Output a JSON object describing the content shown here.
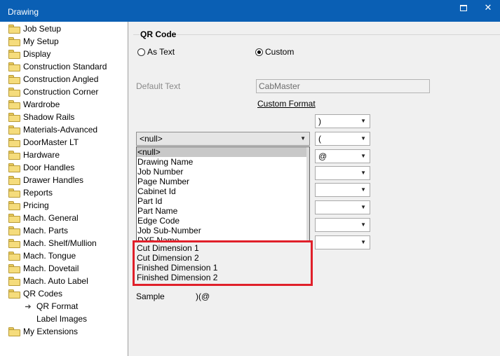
{
  "window": {
    "title": "Drawing",
    "maximize_icon": "maximize-icon",
    "close_label": "✕"
  },
  "tree": {
    "items": [
      {
        "label": "Job Setup"
      },
      {
        "label": "My Setup"
      },
      {
        "label": "Display"
      },
      {
        "label": "Construction Standard"
      },
      {
        "label": "Construction Angled"
      },
      {
        "label": "Construction Corner"
      },
      {
        "label": "Wardrobe"
      },
      {
        "label": "Shadow Rails"
      },
      {
        "label": "Materials-Advanced"
      },
      {
        "label": "DoorMaster LT"
      },
      {
        "label": "Hardware"
      },
      {
        "label": "Door Handles"
      },
      {
        "label": "Drawer Handles"
      },
      {
        "label": "Reports"
      },
      {
        "label": "Pricing"
      },
      {
        "label": "Mach. General"
      },
      {
        "label": "Mach. Parts"
      },
      {
        "label": "Mach. Shelf/Mullion"
      },
      {
        "label": "Mach. Tongue"
      },
      {
        "label": "Mach. Dovetail"
      },
      {
        "label": "Mach. Auto Label"
      },
      {
        "label": "QR Codes"
      }
    ],
    "sub_items": [
      {
        "label": "QR Format",
        "active": true
      },
      {
        "label": "Label Images",
        "active": false
      }
    ],
    "last_item": {
      "label": "My Extensions"
    }
  },
  "qr": {
    "group_title": "QR Code",
    "radio_as_text": "As Text",
    "radio_custom": "Custom",
    "selected": "Custom",
    "default_text_label": "Default Text",
    "default_text_value": "CabMaster",
    "custom_format_link": "Custom Format",
    "main_combo_value": "<null>",
    "separators": [
      ")",
      "(",
      "@",
      "",
      "",
      "",
      "",
      ""
    ],
    "dropdown_options": [
      "<null>",
      "Drawing Name",
      "Job Number",
      "Page Number",
      "Cabinet Id",
      "Part Id",
      "Part Name",
      "Edge Code",
      "Job Sub-Number",
      "DXF Name"
    ],
    "overflow_options": [
      "Cut Dimension 1",
      "Cut Dimension 2",
      "Finished Dimension 1",
      "Finished Dimension 2"
    ],
    "sample_label": "Sample",
    "sample_value": ")(@"
  },
  "colors": {
    "titlebar": "#0a5fb4",
    "highlight": "#e0202a"
  }
}
